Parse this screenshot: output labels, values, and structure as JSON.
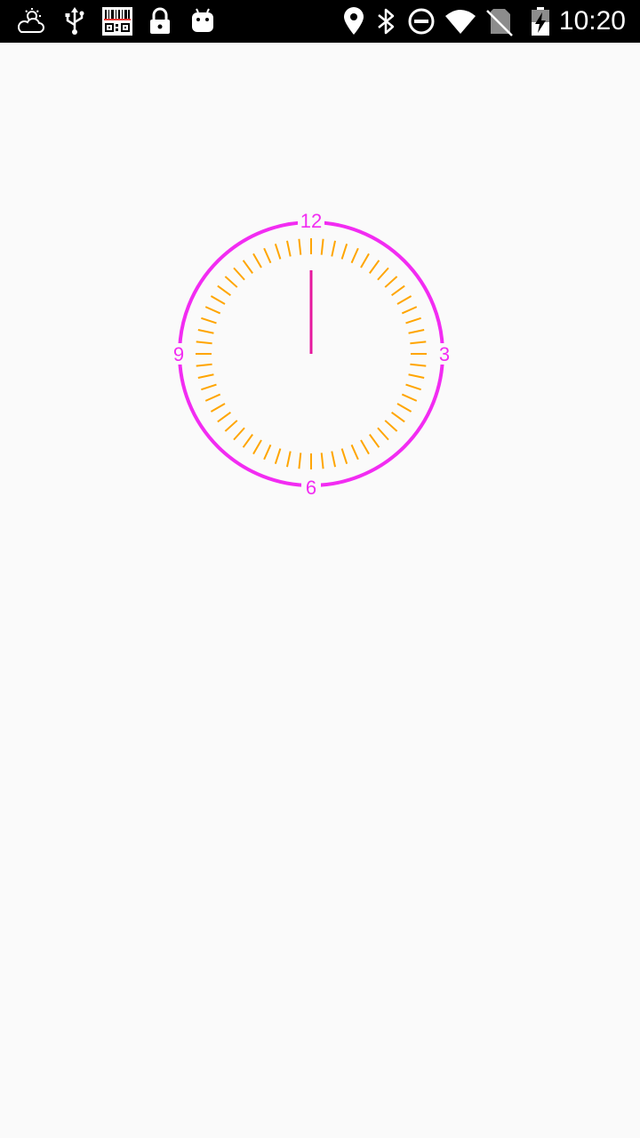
{
  "status_bar": {
    "time": "10:20",
    "left_icons": [
      "weather-cloud-icon",
      "usb-icon",
      "barcode-scanner-icon",
      "lock-icon",
      "android-icon"
    ],
    "right_icons": [
      "location-icon",
      "bluetooth-icon",
      "do-not-disturb-icon",
      "wifi-icon",
      "no-sim-icon",
      "battery-charging-icon"
    ]
  },
  "clock": {
    "numbers": {
      "twelve": "12",
      "three": "3",
      "six": "6",
      "nine": "9"
    },
    "ring_color": "#f22cf2",
    "tick_color": "#ffa500",
    "hand_color": "#e6199e",
    "tick_count": 60,
    "hour_value": 0,
    "minute_value": 0
  }
}
